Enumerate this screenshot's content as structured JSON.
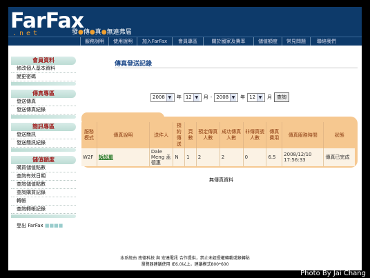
{
  "header": {
    "logo_main": "FarFax",
    "logo_sub": ".net",
    "slogan": [
      "發",
      "傳",
      "真",
      "無遠弗屆"
    ]
  },
  "nav": [
    "服務說明",
    "使用說明",
    "加入FarFax",
    "會員專區",
    "關於國家及費率",
    "儲值額度",
    "常見問題",
    "聯絡我們"
  ],
  "sidebar": {
    "sections": [
      {
        "title": "會員資料",
        "items": [
          "修改個人基本資料",
          "變更密碼"
        ]
      },
      {
        "title": "傳真專區",
        "items": [
          "發送傳真",
          "發送傳真紀錄"
        ]
      },
      {
        "title": "簡訊專區",
        "items": [
          "發送簡訊",
          "發送簡訊紀錄"
        ]
      },
      {
        "title": "儲值額度",
        "items": [
          "購買儲值點數",
          "查詢有效日期",
          "查詢儲值點數",
          "查詢購買記錄",
          "轉帳",
          "查詢轉帳記錄"
        ]
      }
    ],
    "logout": "登出 FarFax"
  },
  "main": {
    "title": "傳真發送記錄",
    "filter": {
      "year_from": "2008",
      "year_label": "年",
      "month_from": "12",
      "month_label": "月",
      "separator": "-",
      "year_to": "2008",
      "month_to": "12",
      "query": "查詢"
    },
    "table": {
      "headers": [
        "服務模式",
        "傳真說明",
        "送件人",
        "預約傳送",
        "頁數",
        "預定傳真人數",
        "成功傳真人數",
        "非傳真號人數",
        "傳真費用",
        "傳真服務時間",
        "狀態"
      ],
      "rows": [
        [
          "W2F",
          "訴訟單",
          "Dale Meng 孟德惠",
          "N",
          "1",
          "2",
          "2",
          "0",
          "6.5",
          "2008/12/10 17:56:33",
          "傳真已完成"
        ]
      ]
    },
    "no_data": "無傳真資料"
  },
  "footer": {
    "line1": "本系統由 南德科技 與 宏達電訊 合作提供，禁止未經授權轉載或錄轉貼",
    "line2": "瀏覽器建議使用 IE6.0以上，建議模式800*600"
  },
  "watermark": "Photo By Jai Chang"
}
